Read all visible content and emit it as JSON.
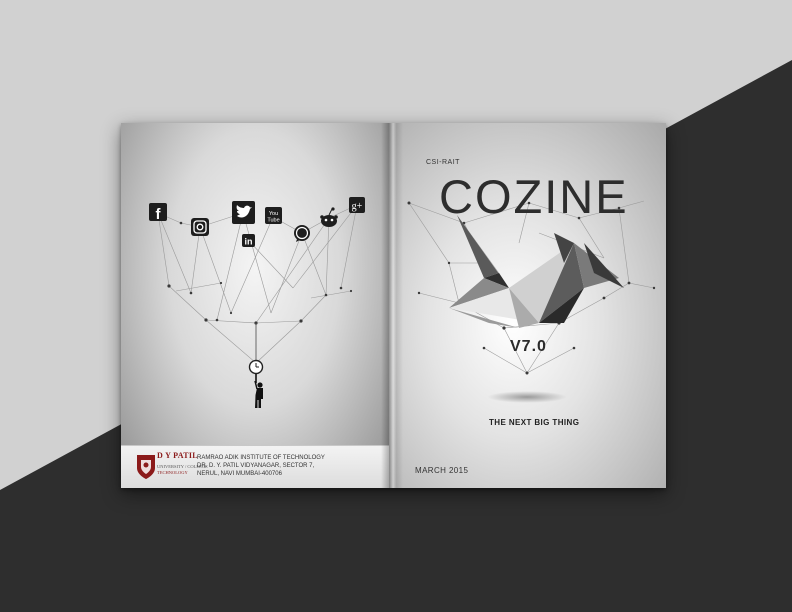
{
  "left_page": {
    "social_icons": [
      "facebook-icon",
      "instagram-icon",
      "twitter-icon",
      "youtube-icon",
      "linkedin-icon",
      "whatsapp-icon",
      "reddit-icon",
      "google-plus-icon"
    ],
    "youtube_label_1": "You",
    "youtube_label_2": "Tube",
    "linkedin_label": "in",
    "googleplus_label": "g+",
    "logo": {
      "name": "D Y PATIL",
      "sub": "UNIVERSITY / COLLEGE",
      "tag": "TECHNOLOGY"
    },
    "address": {
      "line1": "RAMRAO ADIK INSTITUTE OF TECHNOLOGY",
      "line2": "DR. D. Y. PATIL VIDYANAGAR, SECTOR 7,",
      "line3": "NERUL, NAVI MUMBAI-400706"
    }
  },
  "right_page": {
    "publisher": "CSI-RAIT",
    "title": "COZINE",
    "version": "V7.0",
    "tagline": "THE NEXT BIG THING",
    "date": "MARCH 2015"
  },
  "colors": {
    "background_light": "#d1d1d1",
    "background_dark": "#2e2e2e",
    "logo_red": "#8b1a1a"
  }
}
